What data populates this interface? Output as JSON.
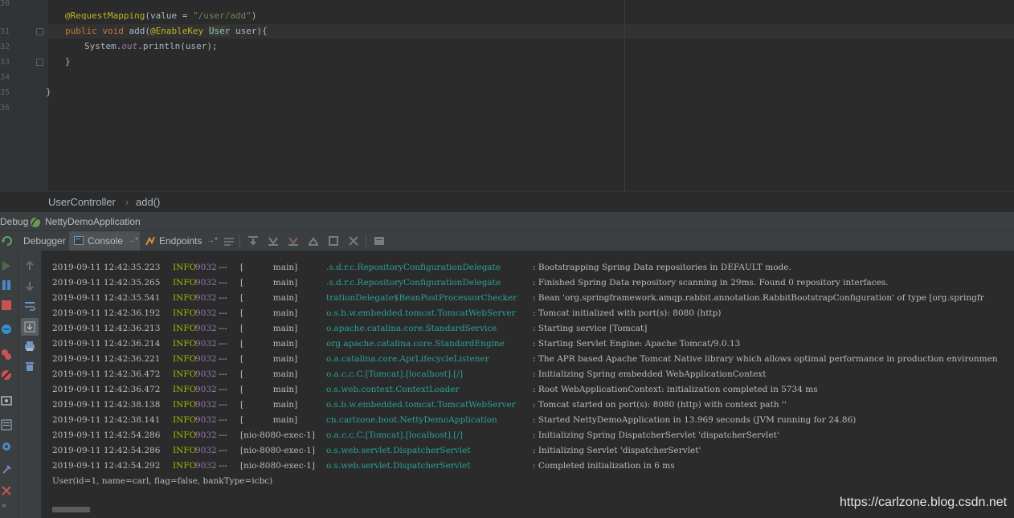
{
  "editor": {
    "line_numbers": [
      "30",
      "31",
      "32",
      "33",
      "34",
      "35",
      "36"
    ],
    "code": {
      "l30_annotation": "@RequestMapping",
      "l30_rest": "(value = ",
      "l30_string": "\"/user/add\"",
      "l30_close": ")",
      "l31_public": "public",
      "l31_void": "void",
      "l31_method": "add(",
      "l31_param_ann": "@EnableKey",
      "l31_type": "User",
      "l31_rest": "user){",
      "l32_system": "System.",
      "l32_out": "out",
      "l32_rest": ".println(user);",
      "l33": "}",
      "l35": "}"
    }
  },
  "breadcrumb": {
    "class_name": "UserController",
    "separator": "›",
    "method": "add()"
  },
  "debug_panel": {
    "label": "Debug",
    "app_name": "NettyDemoApplication"
  },
  "tabs": [
    {
      "label": "Debugger"
    },
    {
      "label": "Console"
    },
    {
      "label": "Endpoints"
    }
  ],
  "tab_pin": "→*",
  "console": {
    "rows": [
      {
        "ts": "2019-09-11 12:42:35.223",
        "level": "INFO",
        "pid": "9032",
        "sep": "---",
        "thread": "[           main]",
        "logger": ".s.d.r.c.RepositoryConfigurationDelegate",
        "msg": ": Bootstrapping Spring Data repositories in DEFAULT mode."
      },
      {
        "ts": "2019-09-11 12:42:35.265",
        "level": "INFO",
        "pid": "9032",
        "sep": "---",
        "thread": "[           main]",
        "logger": ".s.d.r.c.RepositoryConfigurationDelegate",
        "msg": ": Finished Spring Data repository scanning in 29ms. Found 0 repository interfaces."
      },
      {
        "ts": "2019-09-11 12:42:35.541",
        "level": "INFO",
        "pid": "9032",
        "sep": "---",
        "thread": "[           main]",
        "logger": "trationDelegate$BeanPostProcessorChecker",
        "msg": ": Bean 'org.springframework.amqp.rabbit.annotation.RabbitBootstrapConfiguration' of type [org.springfr"
      },
      {
        "ts": "2019-09-11 12:42:36.192",
        "level": "INFO",
        "pid": "9032",
        "sep": "---",
        "thread": "[           main]",
        "logger": "o.s.b.w.embedded.tomcat.TomcatWebServer",
        "msg": ": Tomcat initialized with port(s): 8080 (http)"
      },
      {
        "ts": "2019-09-11 12:42:36.213",
        "level": "INFO",
        "pid": "9032",
        "sep": "---",
        "thread": "[           main]",
        "logger": "o.apache.catalina.core.StandardService",
        "msg": ": Starting service [Tomcat]"
      },
      {
        "ts": "2019-09-11 12:42:36.214",
        "level": "INFO",
        "pid": "9032",
        "sep": "---",
        "thread": "[           main]",
        "logger": "org.apache.catalina.core.StandardEngine",
        "msg": ": Starting Servlet Engine: Apache Tomcat/9.0.13"
      },
      {
        "ts": "2019-09-11 12:42:36.221",
        "level": "INFO",
        "pid": "9032",
        "sep": "---",
        "thread": "[           main]",
        "logger": "o.a.catalina.core.AprLifecycleListener",
        "msg": ": The APR based Apache Tomcat Native library which allows optimal performance in production environmen"
      },
      {
        "ts": "2019-09-11 12:42:36.472",
        "level": "INFO",
        "pid": "9032",
        "sep": "---",
        "thread": "[           main]",
        "logger": "o.a.c.c.C.[Tomcat].[localhost].[/]",
        "msg": ": Initializing Spring embedded WebApplicationContext"
      },
      {
        "ts": "2019-09-11 12:42:36.472",
        "level": "INFO",
        "pid": "9032",
        "sep": "---",
        "thread": "[           main]",
        "logger": "o.s.web.context.ContextLoader",
        "msg": ": Root WebApplicationContext: initialization completed in 5734 ms"
      },
      {
        "ts": "2019-09-11 12:42:38.138",
        "level": "INFO",
        "pid": "9032",
        "sep": "---",
        "thread": "[           main]",
        "logger": "o.s.b.w.embedded.tomcat.TomcatWebServer",
        "msg": ": Tomcat started on port(s): 8080 (http) with context path ''"
      },
      {
        "ts": "2019-09-11 12:42:38.141",
        "level": "INFO",
        "pid": "9032",
        "sep": "---",
        "thread": "[           main]",
        "logger": "cn.carlzone.boot.NettyDemoApplication",
        "msg": ": Started NettyDemoApplication in 13.969 seconds (JVM running for 24.86)"
      },
      {
        "ts": "2019-09-11 12:42:54.286",
        "level": "INFO",
        "pid": "9032",
        "sep": "---",
        "thread": "[nio-8080-exec-1]",
        "logger": "o.a.c.c.C.[Tomcat].[localhost].[/]",
        "msg": ": Initializing Spring DispatcherServlet 'dispatcherServlet'"
      },
      {
        "ts": "2019-09-11 12:42:54.286",
        "level": "INFO",
        "pid": "9032",
        "sep": "---",
        "thread": "[nio-8080-exec-1]",
        "logger": "o.s.web.servlet.DispatcherServlet",
        "msg": ": Initializing Servlet 'dispatcherServlet'"
      },
      {
        "ts": "2019-09-11 12:42:54.292",
        "level": "INFO",
        "pid": "9032",
        "sep": "---",
        "thread": "[nio-8080-exec-1]",
        "logger": "o.s.web.servlet.DispatcherServlet",
        "msg": ": Completed initialization in 6 ms"
      }
    ],
    "output_line": "User(id=1, name=carl, flag=false, bankType=icbc)"
  },
  "watermark": "https://carlzone.blog.csdn.net",
  "colors": {
    "editor_bg": "#2b2b2b",
    "panel_bg": "#3c3f41",
    "info": "#a9b900",
    "pid": "#9876aa",
    "logger": "#2aa198"
  }
}
